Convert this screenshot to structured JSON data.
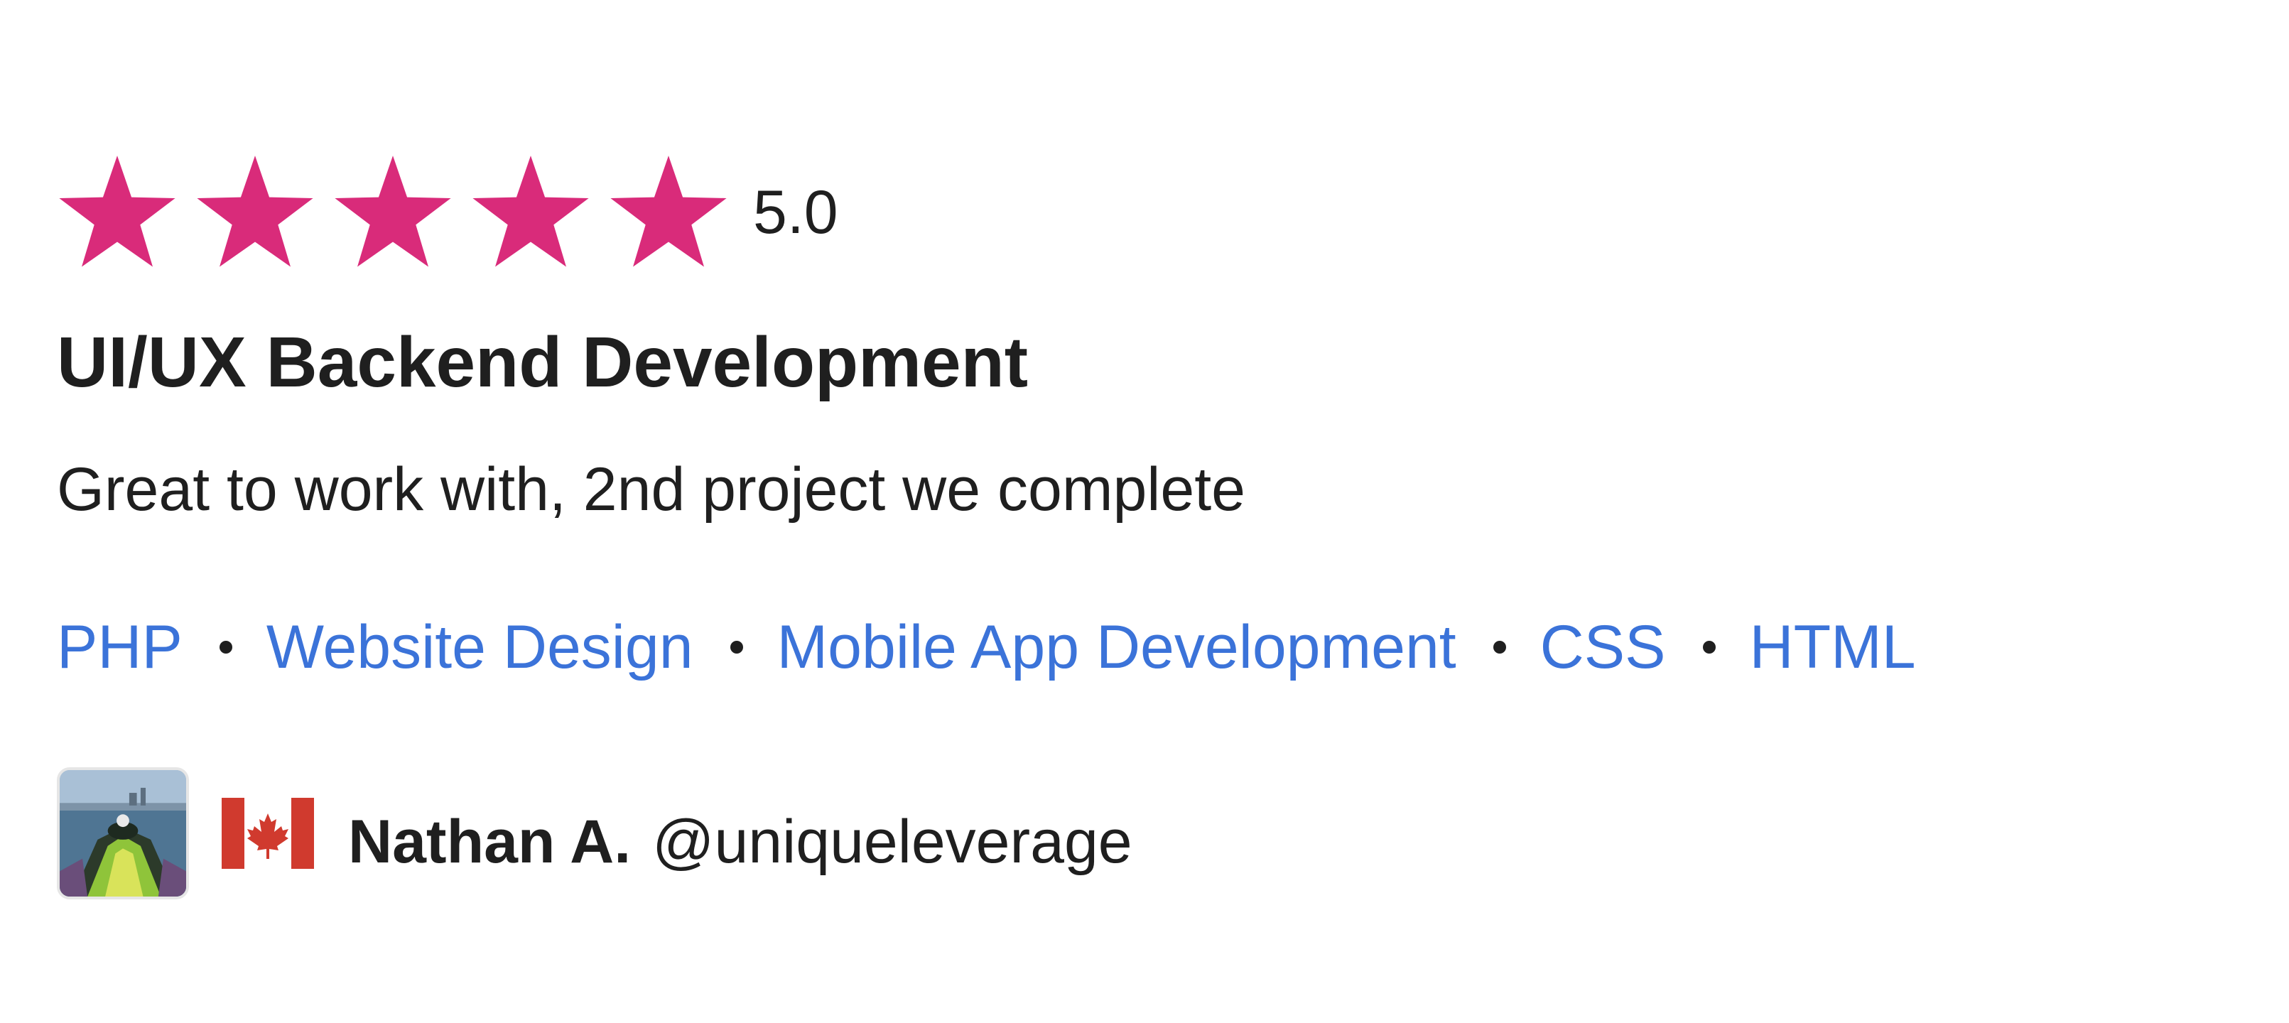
{
  "review": {
    "rating": {
      "stars_filled": 5,
      "stars_total": 5,
      "value_label": "5.0",
      "star_color": "#d92b7a",
      "star_icon": "star-icon"
    },
    "title": "UI/UX Backend Development",
    "comment": "Great to work with, 2nd project we complete",
    "skills": [
      {
        "label": "PHP"
      },
      {
        "label": "Website Design"
      },
      {
        "label": "Mobile App Development"
      },
      {
        "label": "CSS"
      },
      {
        "label": "HTML"
      }
    ],
    "skill_link_color": "#3b73d9",
    "reviewer": {
      "name": "Nathan A.",
      "handle": "@uniqueleverage",
      "avatar_icon": "avatar",
      "flag_icon": "canada-flag-icon"
    }
  }
}
